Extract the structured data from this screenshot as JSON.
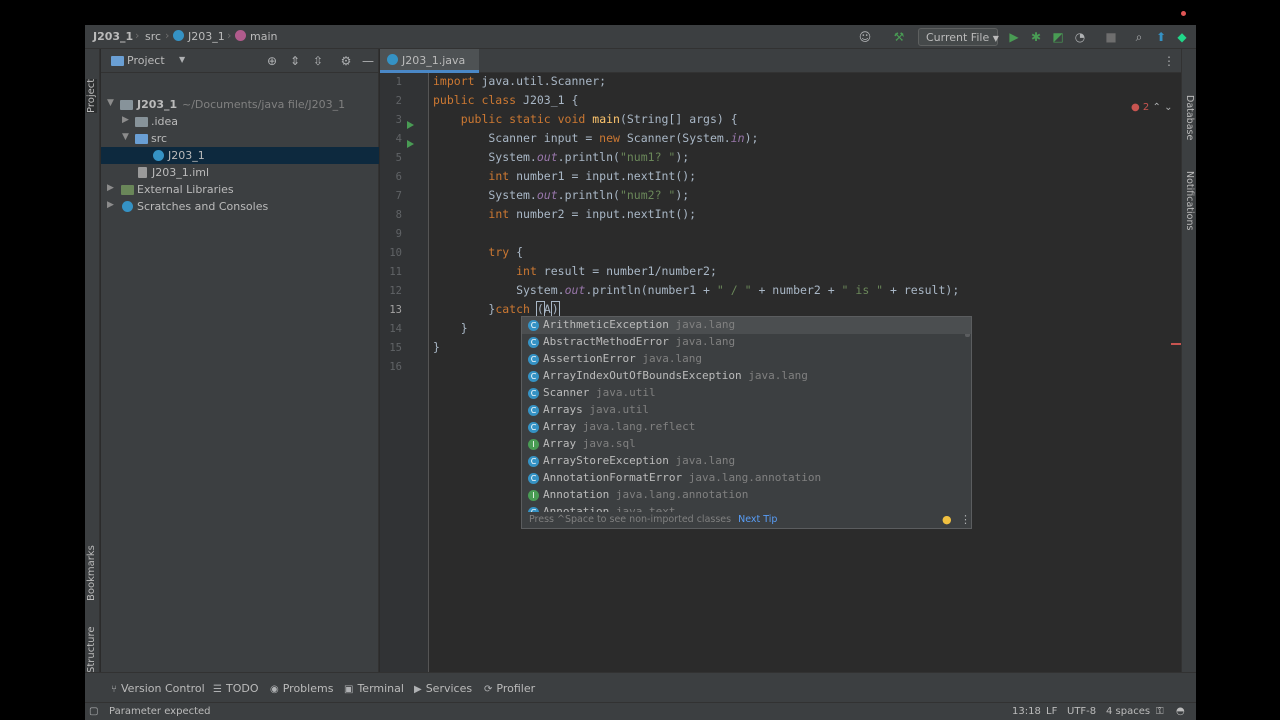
{
  "navbar": {
    "crumbs": [
      "J203_1",
      "src",
      "J203_1",
      "main"
    ],
    "run_config": "Current File"
  },
  "left_stripe": {
    "project_tab": "Project",
    "bookmarks_tab": "Bookmarks",
    "structure_tab": "Structure"
  },
  "right_stripe": {
    "database_tab": "Database",
    "notifications_tab": "Notifications"
  },
  "project": {
    "title": "Project",
    "tree": [
      {
        "label": "J203_1",
        "hint": "~/Documents/java file/J203_1"
      },
      {
        "label": ".idea"
      },
      {
        "label": "src"
      },
      {
        "label": "J203_1"
      },
      {
        "label": "J203_1.iml"
      },
      {
        "label": "External Libraries"
      },
      {
        "label": "Scratches and Consoles"
      }
    ]
  },
  "editor": {
    "tab": "J203_1.java",
    "error_count": "2",
    "line_numbers": [
      "1",
      "2",
      "3",
      "4",
      "5",
      "6",
      "7",
      "8",
      "9",
      "10",
      "11",
      "12",
      "13",
      "14",
      "15",
      "16"
    ],
    "current_line": "13"
  },
  "completion": {
    "items": [
      {
        "icon": "C",
        "name": "ArithmeticException",
        "pkg": "java.lang"
      },
      {
        "icon": "C",
        "name": "AbstractMethodError",
        "pkg": "java.lang"
      },
      {
        "icon": "C",
        "name": "AssertionError",
        "pkg": "java.lang"
      },
      {
        "icon": "C",
        "name": "ArrayIndexOutOfBoundsException",
        "pkg": "java.lang"
      },
      {
        "icon": "C",
        "name": "Scanner",
        "pkg": "java.util"
      },
      {
        "icon": "C",
        "name": "Arrays",
        "pkg": "java.util"
      },
      {
        "icon": "C",
        "name": "Array",
        "pkg": "java.lang.reflect"
      },
      {
        "icon": "I",
        "name": "Array",
        "pkg": "java.sql"
      },
      {
        "icon": "C",
        "name": "ArrayStoreException",
        "pkg": "java.lang"
      },
      {
        "icon": "C",
        "name": "AnnotationFormatError",
        "pkg": "java.lang.annotation"
      },
      {
        "icon": "I",
        "name": "Annotation",
        "pkg": "java.lang.annotation"
      },
      {
        "icon": "C",
        "name": "Annotation",
        "pkg": "java.text"
      }
    ],
    "footer": "Press ^Space to see non-imported classes",
    "next_tip": "Next Tip"
  },
  "toolwindows": [
    "Version Control",
    "TODO",
    "Problems",
    "Terminal",
    "Services",
    "Profiler"
  ],
  "status": {
    "message": "Parameter expected",
    "position": "13:18",
    "line_sep": "LF",
    "encoding": "UTF-8",
    "indent": "4 spaces"
  },
  "colors": {
    "keyword": "#cc7832",
    "method": "#ffc66d",
    "string": "#6a8759",
    "static_field": "#9876aa",
    "accent": "#4a88c7",
    "run_green": "#499c54"
  }
}
